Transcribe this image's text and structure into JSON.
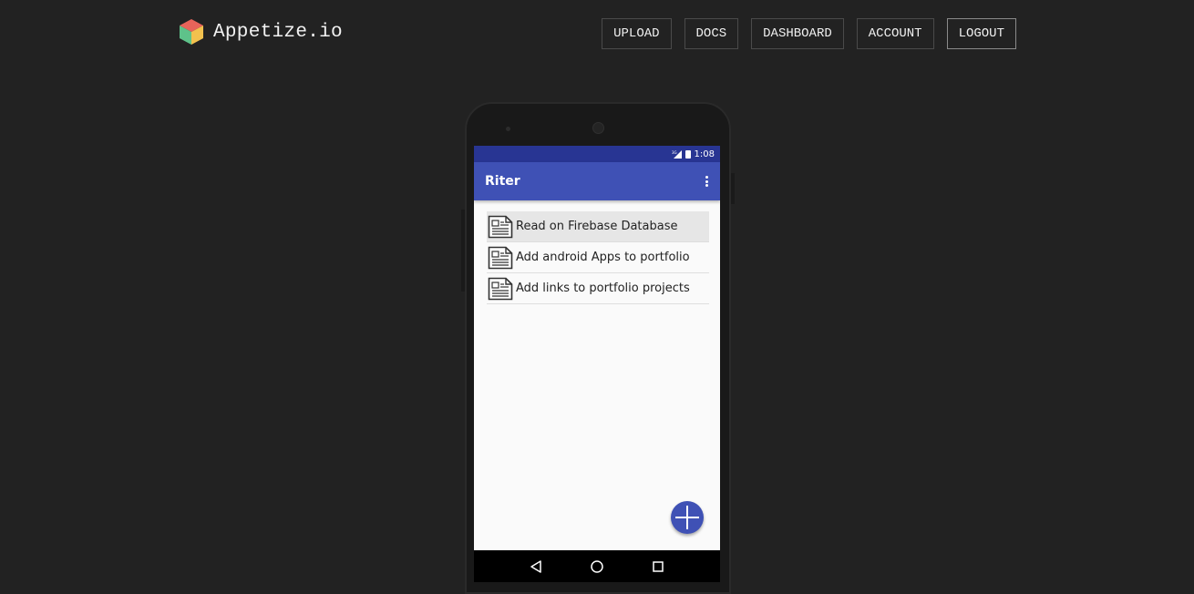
{
  "header": {
    "brand": "Appetize.io",
    "nav": [
      {
        "label": "UPLOAD"
      },
      {
        "label": "DOCS"
      },
      {
        "label": "DASHBOARD"
      },
      {
        "label": "ACCOUNT"
      },
      {
        "label": "LOGOUT"
      }
    ]
  },
  "device": {
    "status_bar": {
      "network": "3G",
      "time": "1:08"
    },
    "app_bar": {
      "title": "Riter"
    },
    "items": [
      {
        "label": "Read on Firebase Database",
        "selected": true
      },
      {
        "label": "Add android Apps to portfolio",
        "selected": false
      },
      {
        "label": "Add links to portfolio projects",
        "selected": false
      }
    ]
  },
  "colors": {
    "page_background": "#222222",
    "status_bar": "#283593",
    "app_bar": "#3f51b5",
    "fab": "#3f51b5"
  }
}
